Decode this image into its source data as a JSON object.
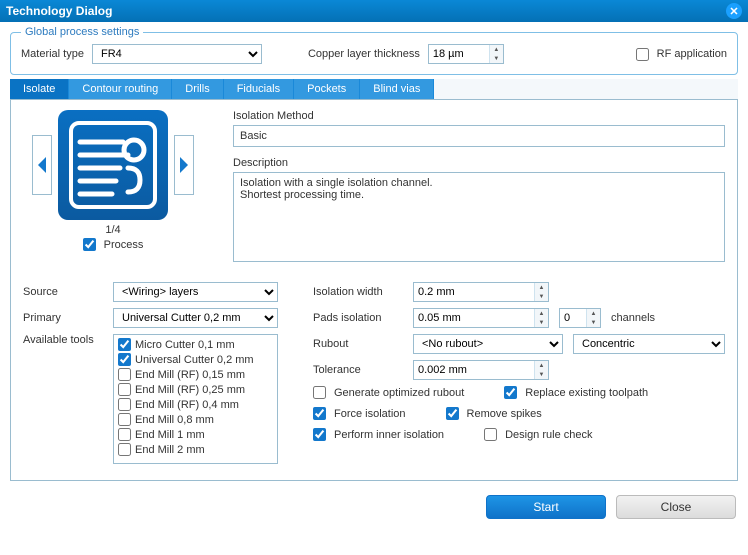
{
  "title": "Technology Dialog",
  "group": {
    "legend": "Global process settings",
    "material_label": "Material type",
    "material_value": "FR4",
    "thickness_label": "Copper layer thickness",
    "thickness_value": "18 µm",
    "rf_label": "RF application",
    "rf_checked": false
  },
  "tabs": [
    "Isolate",
    "Contour routing",
    "Drills",
    "Fiducials",
    "Pockets",
    "Blind vias"
  ],
  "active_tab": 0,
  "preview": {
    "counter": "1/4",
    "process_label": "Process",
    "process_checked": true
  },
  "isolation": {
    "method_label": "Isolation Method",
    "method_value": "Basic",
    "description_label": "Description",
    "description_value": "Isolation with a single isolation channel.\nShortest processing time."
  },
  "left": {
    "source_label": "Source",
    "source_value": "<Wiring> layers",
    "primary_label": "Primary",
    "primary_value": "Universal Cutter 0,2 mm",
    "tools_label": "Available tools",
    "tools": [
      {
        "label": "Micro Cutter 0,1 mm",
        "checked": true
      },
      {
        "label": "Universal Cutter 0,2 mm",
        "checked": true
      },
      {
        "label": "End Mill (RF) 0,15 mm",
        "checked": false
      },
      {
        "label": "End Mill (RF) 0,25 mm",
        "checked": false
      },
      {
        "label": "End Mill (RF) 0,4 mm",
        "checked": false
      },
      {
        "label": "End Mill 0,8 mm",
        "checked": false
      },
      {
        "label": "End Mill 1 mm",
        "checked": false
      },
      {
        "label": "End Mill 2 mm",
        "checked": false
      }
    ]
  },
  "right": {
    "iso_width_label": "Isolation width",
    "iso_width_value": "0.2 mm",
    "pads_label": "Pads isolation",
    "pads_value": "0.05 mm",
    "pads_channels": "0",
    "channels_label": "channels",
    "rubout_label": "Rubout",
    "rubout_value": "<No rubout>",
    "rubout_mode": "Concentric",
    "tolerance_label": "Tolerance",
    "tolerance_value": "0.002 mm",
    "cb_gen": "Generate optimized rubout",
    "cb_gen_checked": false,
    "cb_rep": "Replace existing toolpath",
    "cb_rep_checked": true,
    "cb_force": "Force isolation",
    "cb_force_checked": true,
    "cb_spikes": "Remove spikes",
    "cb_spikes_checked": true,
    "cb_inner": "Perform inner isolation",
    "cb_inner_checked": true,
    "cb_drc": "Design rule check",
    "cb_drc_checked": false
  },
  "footer": {
    "start": "Start",
    "close": "Close"
  }
}
